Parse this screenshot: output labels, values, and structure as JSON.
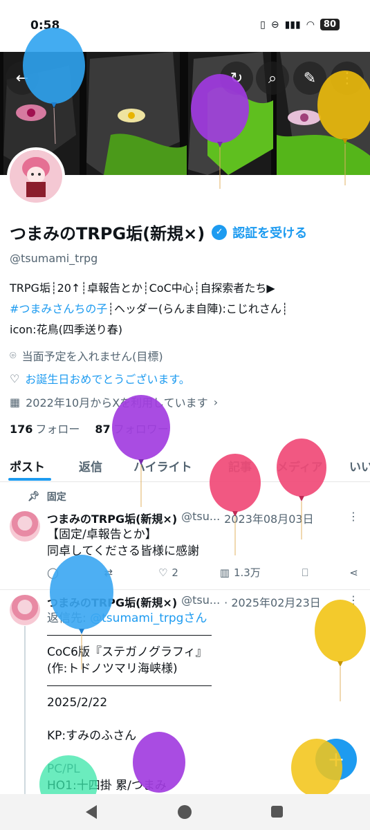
{
  "status_bar": {
    "time": "0:58",
    "battery": "80",
    "icons": [
      "vibrate-icon",
      "dnd-icon",
      "signal-icon",
      "wifi-icon"
    ]
  },
  "header_buttons": [
    "back-arrow-icon",
    "refresh-icon",
    "search-icon",
    "edit-icon",
    "more-vert-icon"
  ],
  "profile": {
    "name": "つまみのTRPG垢(新規×)",
    "verify_link": "認証を受ける",
    "handle": "@tsumami_trpg",
    "bio_line1": "TRPG垢┊20↑┊卓報告とか┊CoC中心┊自探索者たち▶",
    "bio_hashtag": "#つまみさんちの子",
    "bio_line2_rest": "┊ヘッダー(らんま自陣):こじれさん┊",
    "bio_line3": "icon:花鳥(四季送り春)",
    "location": "当面予定を入れません(目標)",
    "birthday": "お誕生日おめでとうございます。",
    "joined": "2022年10月からXを利用しています",
    "following_count": "176",
    "following_label": "フォロー",
    "followers_count": "87",
    "followers_label": "フォロワー"
  },
  "tabs": [
    "ポスト",
    "返信",
    "ハイライト",
    "記事",
    "メディア",
    "いい"
  ],
  "pinned_label": "固定",
  "tweets": [
    {
      "name": "つまみのTRPG垢(新規×)",
      "handle": "@tsu...",
      "date": "2023年08月03日",
      "line1": "【固定/卓報告とか】",
      "line2": "同卓してくださる皆様に感謝",
      "replies": "",
      "retweets": "",
      "likes": "2",
      "views": "1.3万"
    },
    {
      "name": "つまみのTRPG垢(新規×)",
      "handle": "@tsu...",
      "date": "· 2025年02月23日",
      "reply_to_prefix": "返信先:",
      "reply_to_user": "@tsumami_trpgさん",
      "line1": "CoC6版『ステガノグラフィ』",
      "line2": "(作:トドノツマリ海峡様)",
      "line3": "2025/2/22",
      "line4": "KP:すみのふさん",
      "line5": "PC/PL",
      "line6": "HO1:十四掛 累/つまみ"
    }
  ],
  "fab_icon": "+",
  "colors": {
    "accent": "#1d9bf0",
    "text": "#0f1419",
    "secondary": "#536471"
  }
}
